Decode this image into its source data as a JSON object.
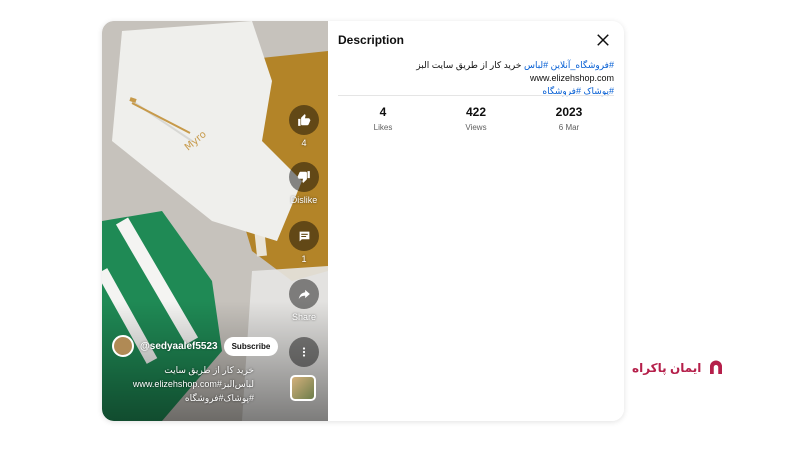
{
  "video": {
    "channel_handle": "@sedyaalef5523",
    "subscribe_label": "Subscribe",
    "caption_line1": "خرید کار از طریق سایت",
    "caption_line2": "www.elizehshop.com#لباس‌البز",
    "caption_line3": "#پوشاک#فروشگاه",
    "actions": {
      "like_count": "4",
      "dislike_label": "Dislike",
      "comment_count": "1",
      "share_label": "Share"
    },
    "icons": [
      "thumb-up-icon",
      "thumb-down-icon",
      "comment-icon",
      "share-icon",
      "more-vert-icon"
    ]
  },
  "description": {
    "title": "Description",
    "text_part1": "#فروشگاه_آنلاین #لباس",
    "text_part2": "خرید کار از طریق سایت البز",
    "text_url": "www.elizehshop.com",
    "text_tags2": "#پوشاک #فروشگاه",
    "stats": [
      {
        "value": "4",
        "caption": "Likes"
      },
      {
        "value": "422",
        "caption": "Views"
      },
      {
        "value": "2023",
        "caption": "6 Mar"
      }
    ]
  },
  "brand": {
    "name": "ایمان پاکراه",
    "color": "#b51f4a"
  },
  "colors": {
    "link": "#065fd4",
    "text": "#0f0f0f",
    "muted": "#606060"
  }
}
